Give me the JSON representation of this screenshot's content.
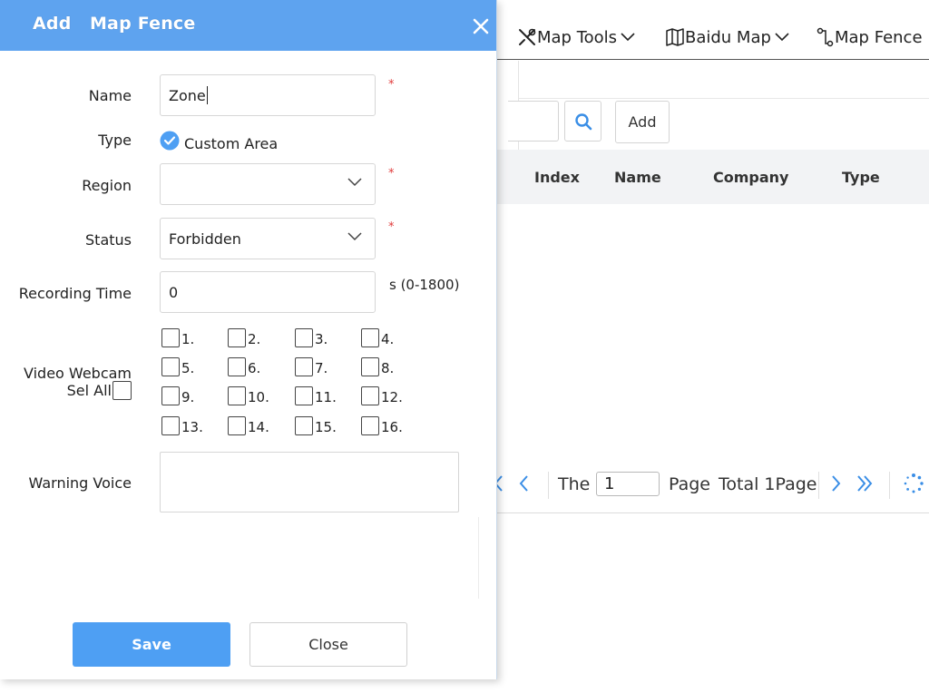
{
  "toolbar": {
    "map_tools_label": "Map Tools",
    "baidu_map_label": "Baidu Map",
    "map_fence_label": "Map Fence"
  },
  "filter": {
    "add_label": "Add"
  },
  "table": {
    "columns": [
      "Index",
      "Name",
      "Company",
      "Type"
    ]
  },
  "pager": {
    "the_label": "The",
    "current_page": "1",
    "page_label": "Page",
    "total_label": "Total 1Page"
  },
  "modal": {
    "title": "Add   Map Fence",
    "name_label": "Name",
    "name_value": "Zone",
    "type_label": "Type",
    "type_option": "Custom Area",
    "region_label": "Region",
    "region_value": "",
    "status_label": "Status",
    "status_value": "Forbidden",
    "recording_label": "Recording Time",
    "recording_value": "0",
    "recording_hint": "s (0-1800)",
    "video_label": "Video Webcam",
    "sel_all_label": "Sel All",
    "cameras": [
      "1.",
      "2.",
      "3.",
      "4.",
      "5.",
      "6.",
      "7.",
      "8.",
      "9.",
      "10.",
      "11.",
      "12.",
      "13.",
      "14.",
      "15.",
      "16."
    ],
    "warning_label": "Warning Voice",
    "required_mark": "*",
    "save_label": "Save",
    "close_label": "Close"
  },
  "colors": {
    "header_blue": "#5ea3ef",
    "save_blue": "#4e9ff3",
    "accent_blue": "#3a8ee6",
    "required_red": "#e03a3a"
  },
  "icons": [
    "close-icon",
    "tools-icon",
    "map-icon",
    "fence-icon",
    "chevron-down-icon",
    "search-icon",
    "check-circle-icon",
    "chevron-left-icon",
    "chevron-right-icon",
    "double-chevron-right-icon",
    "loading-spinner-icon"
  ]
}
